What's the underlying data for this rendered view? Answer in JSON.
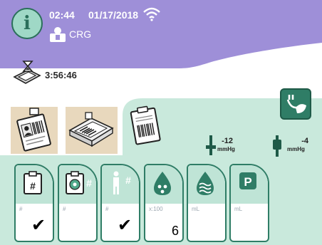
{
  "status": {
    "time": "02:44",
    "date": "01/17/2018",
    "user": "CRG"
  },
  "timer": {
    "value": "3:56:46"
  },
  "tabs": [
    "patient-id-tab",
    "device-barcode-tab",
    "clipboard-barcode-tab"
  ],
  "pressures": [
    {
      "value": "-12",
      "unit": "mmHg",
      "icon": "pressure-down-icon"
    },
    {
      "value": "-4",
      "unit": "mmHg",
      "icon": "pressure-up-icon"
    }
  ],
  "cards": [
    {
      "icon": "clipboard-number-icon",
      "unit": "#",
      "checked": true,
      "value": ""
    },
    {
      "icon": "settings-number-icon",
      "unit": "#",
      "checked": false,
      "value": ""
    },
    {
      "icon": "person-number-icon",
      "unit": "#",
      "checked": true,
      "value": ""
    },
    {
      "icon": "drops-icon",
      "unit": "x:100",
      "checked": false,
      "value": "6"
    },
    {
      "icon": "waves-drop-icon",
      "unit": "mL",
      "checked": false,
      "value": ""
    },
    {
      "icon": "p-box-icon",
      "unit": "mL",
      "checked": false,
      "value": ""
    }
  ],
  "symbols": {
    "check": "✔"
  },
  "colors": {
    "header": "#9e8fd8",
    "accent": "#2f7d66",
    "panel": "#c9e9dc",
    "tab": "#e8d8bd"
  }
}
